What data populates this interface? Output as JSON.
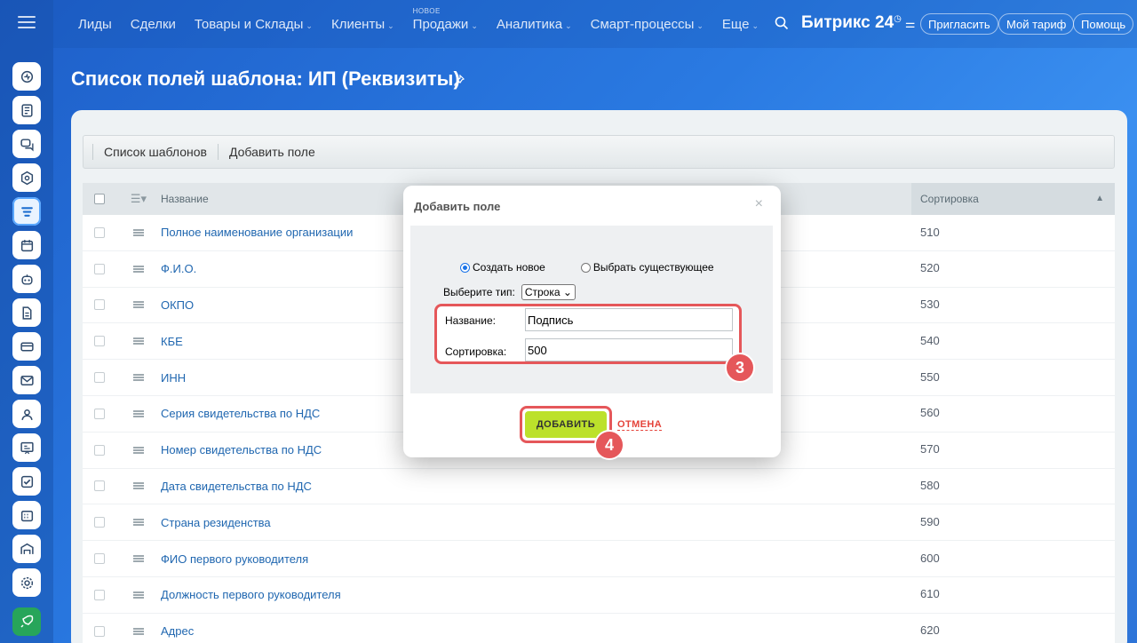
{
  "nav": {
    "items": [
      {
        "label": "Лиды",
        "chevron": false
      },
      {
        "label": "Сделки",
        "chevron": false
      },
      {
        "label": "Товары и Склады",
        "chevron": true
      },
      {
        "label": "Клиенты",
        "chevron": true
      },
      {
        "label": "Продажи",
        "chevron": true,
        "badge": "НОВОЕ"
      },
      {
        "label": "Аналитика",
        "chevron": true
      },
      {
        "label": "Смарт-процессы",
        "chevron": true
      },
      {
        "label": "Еще",
        "chevron": true
      }
    ],
    "brand": "Битрикс 24",
    "invite": "Пригласить",
    "plan": "Мой тариф",
    "help": "Помощь"
  },
  "rail": {
    "icons": [
      "activity-icon",
      "feed-icon",
      "chat-icon",
      "hexagon-icon",
      "crm-icon",
      "calendar-icon",
      "robot-icon",
      "document-icon",
      "card-icon",
      "mail-icon",
      "contacts-icon",
      "presentation-icon",
      "tasks-icon",
      "schedule-icon",
      "warehouse-icon",
      "settings-icon"
    ],
    "active_index": 4
  },
  "page": {
    "title": "Список полей шаблона: ИП (Реквизиты)"
  },
  "toolbar": {
    "templates": "Список шаблонов",
    "add_field": "Добавить поле"
  },
  "grid": {
    "header_name": "Название",
    "header_sort": "Сортировка",
    "rows": [
      {
        "name": "Полное наименование организации",
        "sort": "510"
      },
      {
        "name": "Ф.И.О.",
        "sort": "520"
      },
      {
        "name": "ОКПО",
        "sort": "530"
      },
      {
        "name": "КБЕ",
        "sort": "540"
      },
      {
        "name": "ИНН",
        "sort": "550"
      },
      {
        "name": "Серия свидетельства по НДС",
        "sort": "560"
      },
      {
        "name": "Номер свидетельства по НДС",
        "sort": "570"
      },
      {
        "name": "Дата свидетельства по НДС",
        "sort": "580"
      },
      {
        "name": "Страна резиденства",
        "sort": "590"
      },
      {
        "name": "ФИО первого руководителя",
        "sort": "600"
      },
      {
        "name": "Должность первого руководителя",
        "sort": "610"
      },
      {
        "name": "Адрес",
        "sort": "620"
      }
    ]
  },
  "dialog": {
    "title": "Добавить поле",
    "close": "×",
    "radio_new": "Создать новое",
    "radio_existing": "Выбрать существующее",
    "type_label": "Выберите тип:",
    "type_value": "Строка",
    "name_label": "Название:",
    "name_value": "Подпись",
    "sort_label": "Сортировка:",
    "sort_value": "500",
    "add_button": "ДОБАВИТЬ",
    "cancel": "ОТМЕНА",
    "step3": "3",
    "step4": "4"
  },
  "colors": {
    "accent_green": "#bce12b",
    "highlight_red": "#e5575a",
    "link_blue": "#2067b0"
  }
}
